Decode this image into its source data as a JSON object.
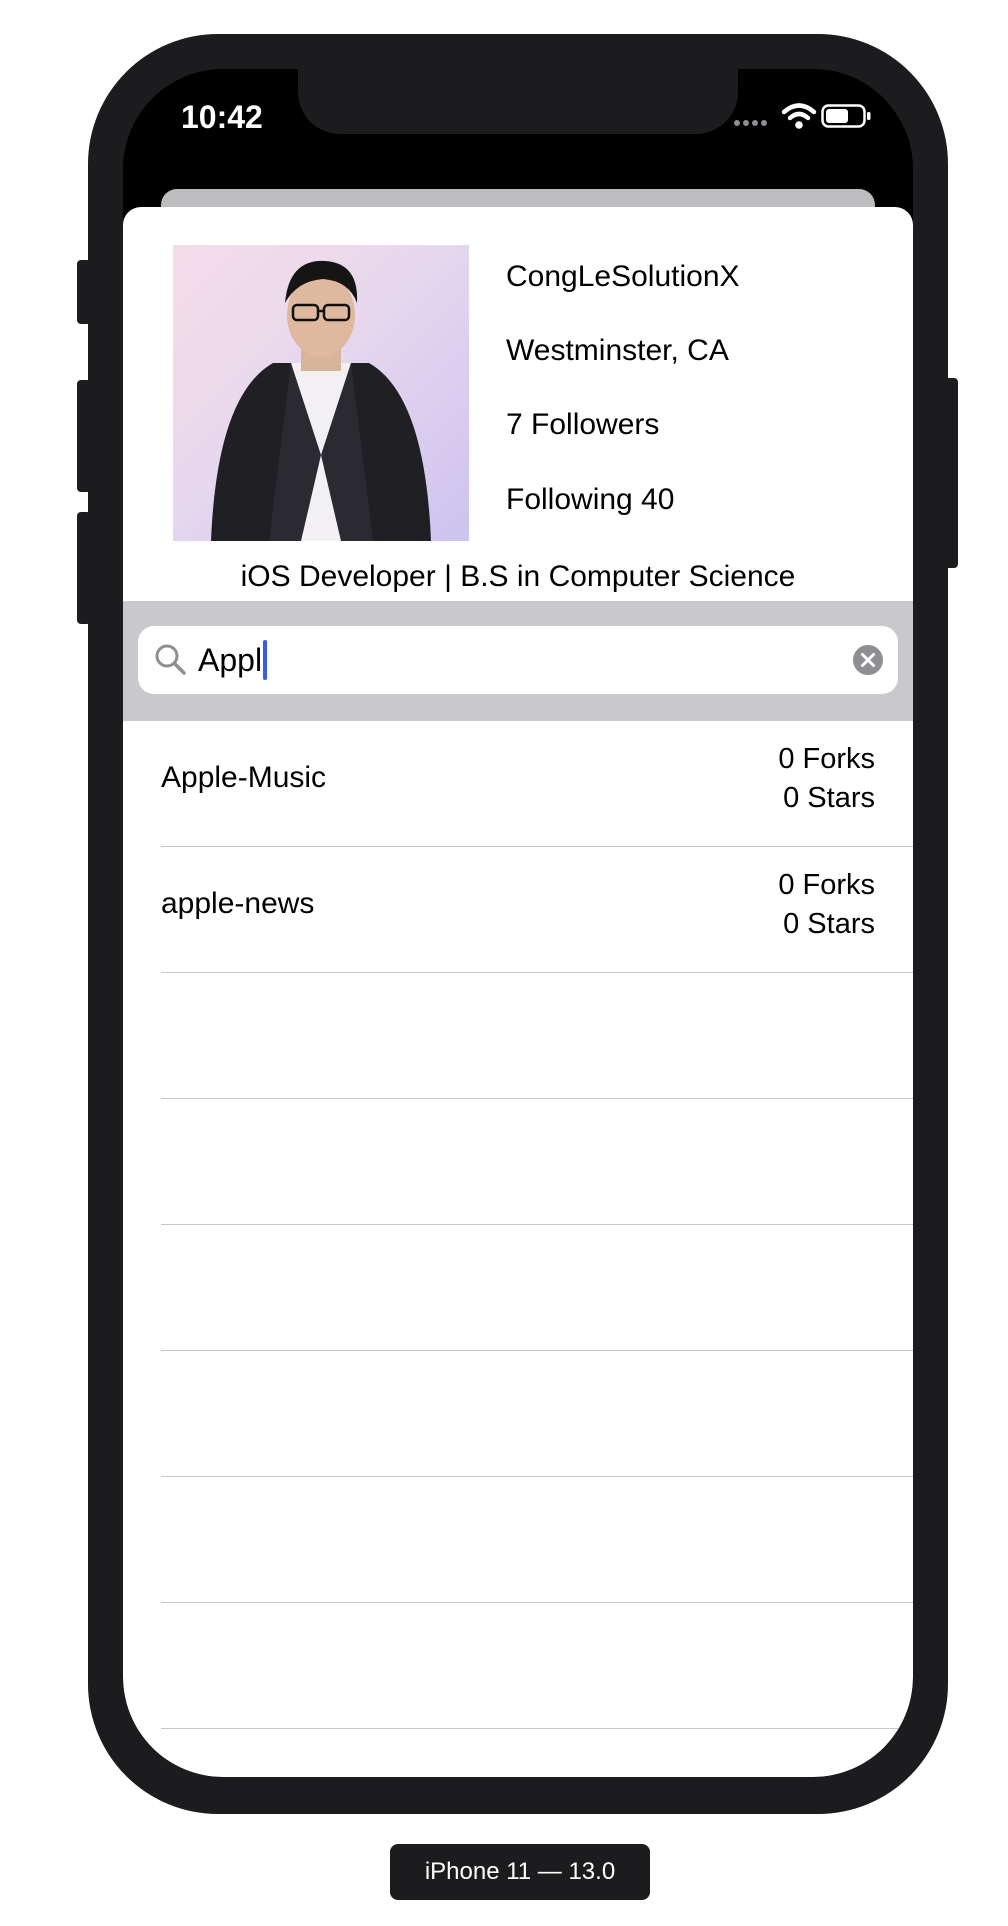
{
  "status_bar": {
    "time": "10:42",
    "icons": [
      "cellular-dots-icon",
      "wifi-icon",
      "battery-icon"
    ]
  },
  "profile": {
    "username": "CongLeSolutionX",
    "location": "Westminster, CA",
    "followers": "7 Followers",
    "following": "Following 40",
    "bio": "iOS Developer | B.S in Computer Science"
  },
  "search": {
    "value": "Appl"
  },
  "repos": [
    {
      "name": "Apple-Music",
      "forks": "0 Forks",
      "stars": "0 Stars"
    },
    {
      "name": "apple-news",
      "forks": "0 Forks",
      "stars": "0 Stars"
    }
  ],
  "device_label": "iPhone 11 — 13.0",
  "colors": {
    "caret": "#3a5bea",
    "search_bar_bg": "#c8c8cd",
    "device_frame": "#1c1c1e"
  }
}
